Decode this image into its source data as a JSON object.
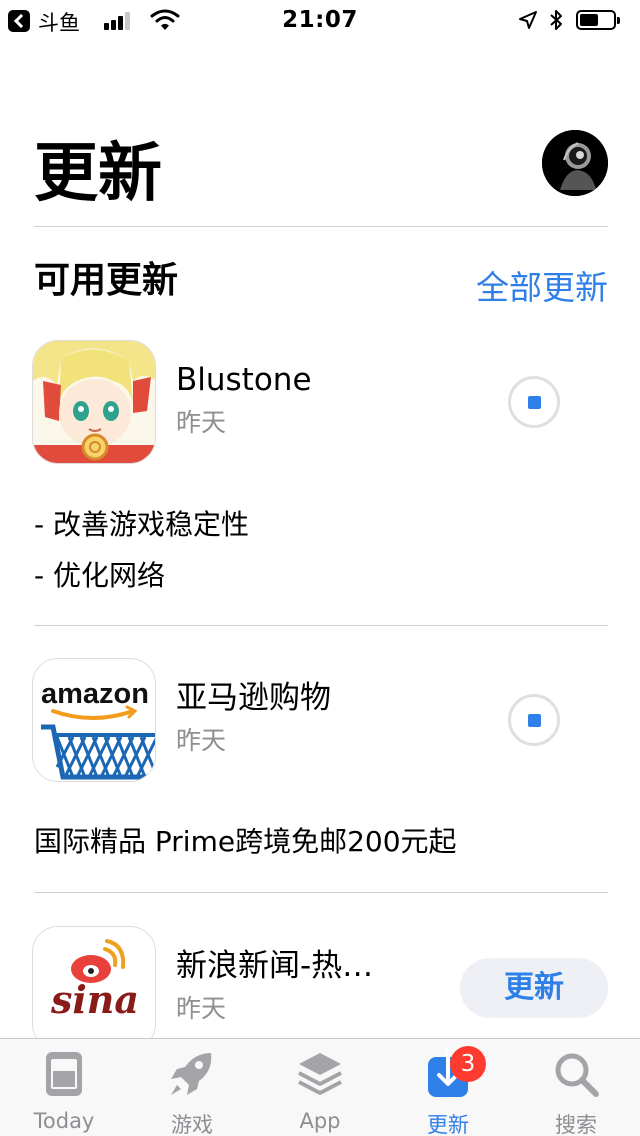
{
  "status_bar": {
    "app_name": "斗鱼",
    "time": "21:07",
    "signal_bars": 3,
    "battery_level": 0.55
  },
  "header": {
    "title": "更新"
  },
  "section": {
    "title": "可用更新",
    "update_all_label": "全部更新"
  },
  "apps": [
    {
      "name": "Blustone",
      "date": "昨天",
      "notes": [
        "- 改善游戏稳定性",
        "- 优化网络"
      ],
      "state": "downloading"
    },
    {
      "name": "亚马逊购物",
      "date": "昨天",
      "icon_text": "amazon",
      "notes": [
        "国际精品 Prime跨境免邮200元起"
      ],
      "state": "downloading"
    },
    {
      "name": "新浪新闻-热…",
      "date": "昨天",
      "icon_text": "sina",
      "state": "update",
      "button_label": "更新"
    }
  ],
  "tab_bar": {
    "tabs": [
      {
        "label": "Today",
        "icon": "today-icon"
      },
      {
        "label": "游戏",
        "icon": "rocket-icon"
      },
      {
        "label": "App",
        "icon": "layers-icon"
      },
      {
        "label": "更新",
        "icon": "download-icon",
        "badge": "3",
        "active": true
      },
      {
        "label": "搜索",
        "icon": "search-icon"
      }
    ]
  },
  "colors": {
    "accent": "#2f7fe8",
    "badge": "#ff3b30",
    "secondary_text": "#8e8e93"
  }
}
